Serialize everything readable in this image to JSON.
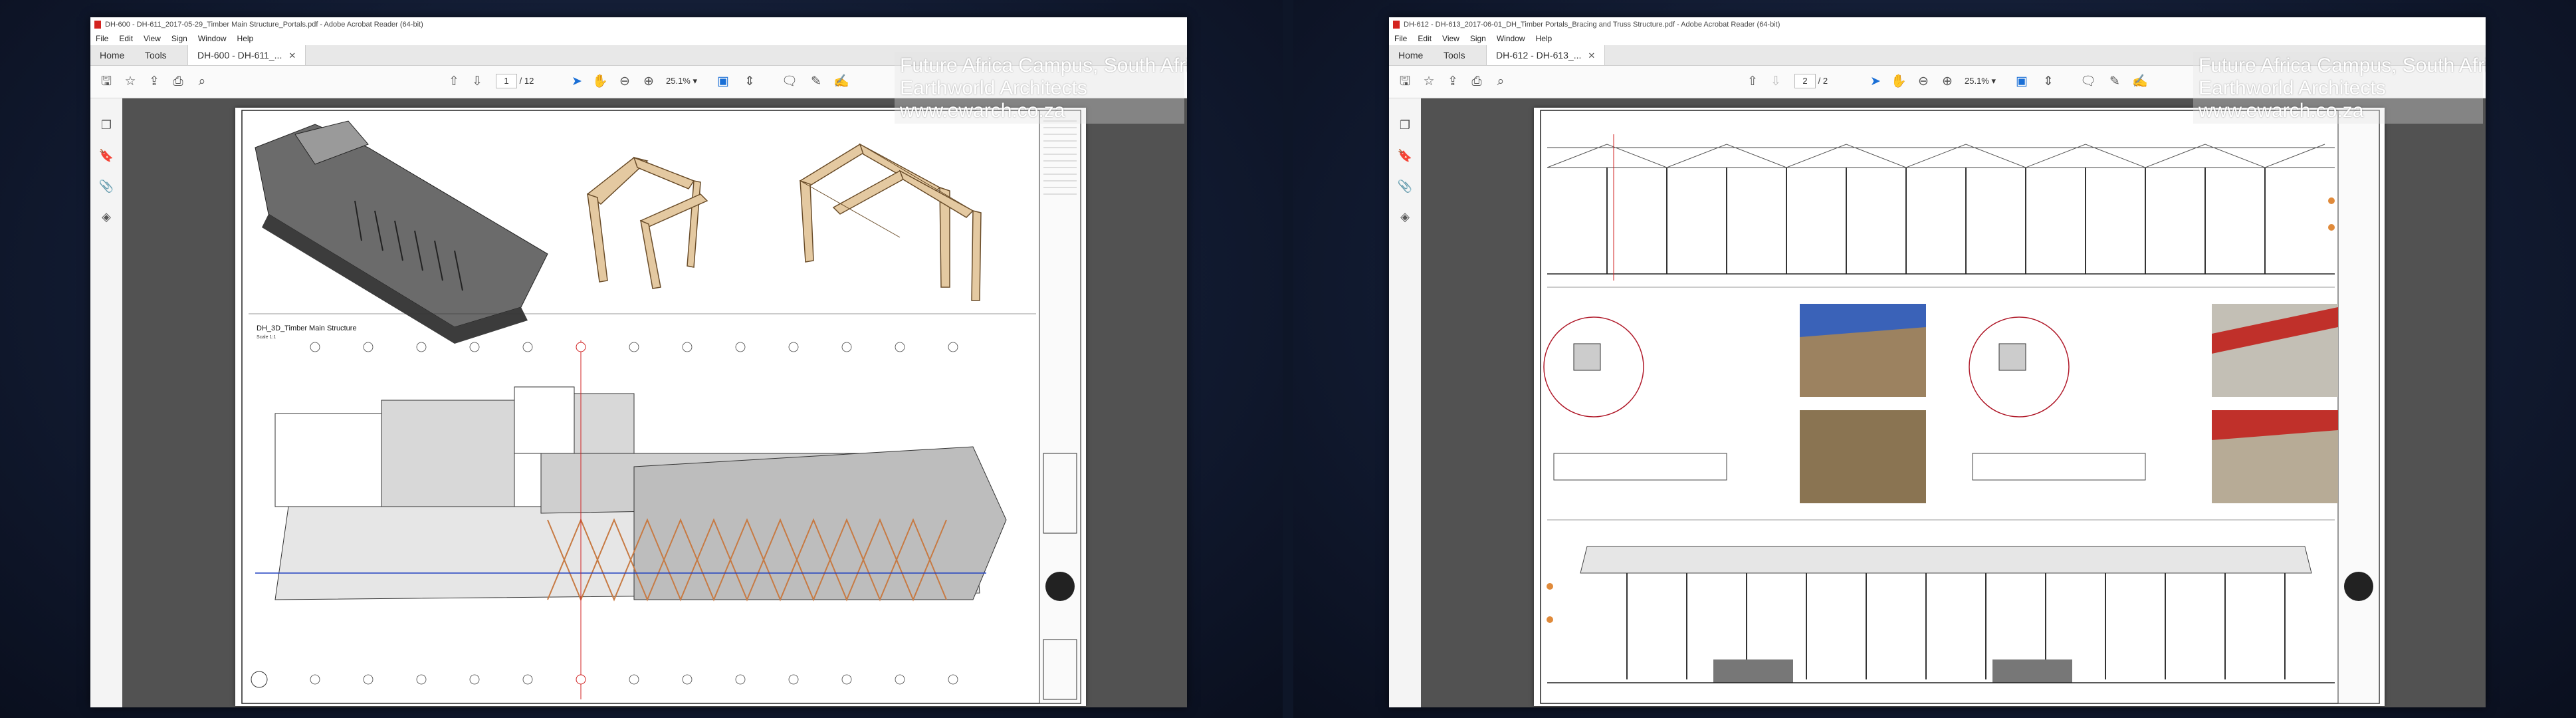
{
  "windows": [
    {
      "title": "DH-600 - DH-611_2017-05-29_Timber Main Structure_Portals.pdf - Adobe Acrobat Reader (64-bit)",
      "menu": [
        "File",
        "Edit",
        "View",
        "Sign",
        "Window",
        "Help"
      ],
      "tabs": {
        "home": "Home",
        "tools": "Tools",
        "document": "DH-600 - DH-611_..."
      },
      "page_current": "1",
      "page_total": "/ 12",
      "zoom": "25.1%",
      "drawing_title": "DH_3D_Timber Main Structure",
      "drawing_subtitle": "Scale 1:1"
    },
    {
      "title": "DH-612 - DH-613_2017-06-01_DH_Timber Portals_Bracing and Truss Structure.pdf - Adobe Acrobat Reader (64-bit)",
      "menu": [
        "File",
        "Edit",
        "View",
        "Sign",
        "Window",
        "Help"
      ],
      "tabs": {
        "home": "Home",
        "tools": "Tools",
        "document": "DH-612 - DH-613_..."
      },
      "page_current": "2",
      "page_total": "/ 2",
      "zoom": "25.1%"
    }
  ],
  "watermark": {
    "line1": "Future Africa Campus, South Africa",
    "line2": "Earthworld Architects",
    "line3": "www.ewarch.co.za"
  },
  "icons": {
    "save": "save-icon",
    "bookmark": "star-icon",
    "upload": "upload-icon",
    "print": "print-icon",
    "search": "search-icon",
    "page_up": "arrow-up-icon",
    "page_down": "arrow-down-icon",
    "select": "cursor-icon",
    "hand": "hand-icon",
    "zoom_out": "zoom-out-icon",
    "zoom_in": "zoom-in-icon",
    "comment": "comment-icon",
    "pen": "pen-icon",
    "sign": "sign-icon"
  }
}
